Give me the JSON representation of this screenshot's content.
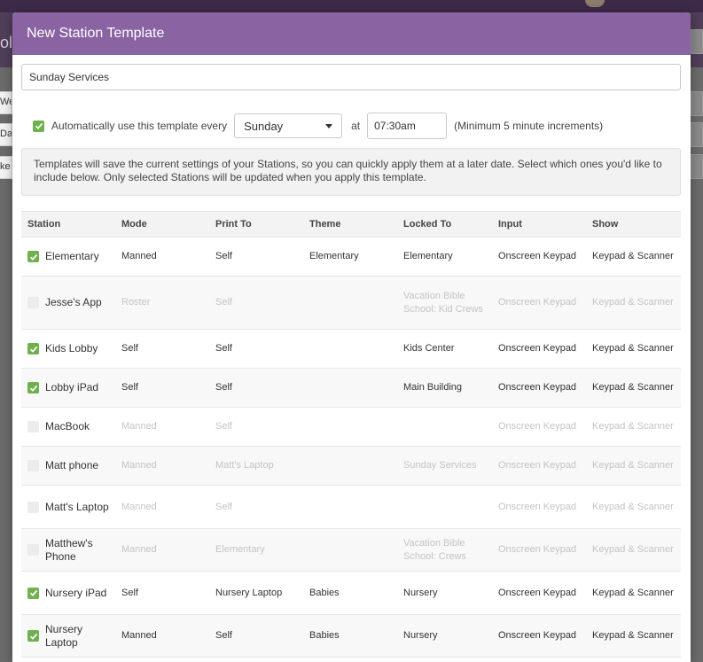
{
  "background": {
    "side_tabs": [
      "Wee",
      "Day",
      "ke"
    ],
    "logo_fragment": "ol"
  },
  "modal": {
    "title": "New Station Template",
    "template_name": "Sunday Services",
    "auto": {
      "checked": true,
      "label": "Automatically use this template every",
      "day": "Sunday",
      "at_label": "at",
      "time": "07:30am",
      "note": "(Minimum 5 minute increments)"
    },
    "info": "Templates will save the current settings of your Stations, so you can quickly apply them at a later date. Select which ones you'd like to include below. Only selected Stations will be updated when you apply this template.",
    "columns": [
      "Station",
      "Mode",
      "Print To",
      "Theme",
      "Locked To",
      "Input",
      "Show"
    ],
    "rows": [
      {
        "checked": true,
        "station": "Elementary",
        "mode": "Manned",
        "print_to": "Self",
        "theme": "Elementary",
        "locked_to": "Elementary",
        "input": "Onscreen Keypad",
        "show": "Keypad & Scanner"
      },
      {
        "checked": false,
        "station": "Jesse's App",
        "mode": "Roster",
        "print_to": "Self",
        "theme": "",
        "locked_to": "Vacation Bible School: Kid Crews",
        "input": "Onscreen Keypad",
        "show": "Keypad & Scanner"
      },
      {
        "checked": true,
        "station": "Kids Lobby",
        "mode": "Self",
        "print_to": "Self",
        "theme": "",
        "locked_to": "Kids Center",
        "input": "Onscreen Keypad",
        "show": "Keypad & Scanner"
      },
      {
        "checked": true,
        "station": "Lobby iPad",
        "mode": "Self",
        "print_to": "Self",
        "theme": "",
        "locked_to": "Main Building",
        "input": "Onscreen Keypad",
        "show": "Keypad & Scanner"
      },
      {
        "checked": false,
        "station": "MacBook",
        "mode": "Manned",
        "print_to": "Self",
        "theme": "",
        "locked_to": "",
        "input": "Onscreen Keypad",
        "show": "Keypad & Scanner"
      },
      {
        "checked": false,
        "station": "Matt phone",
        "mode": "Manned",
        "print_to": "Matt's Laptop",
        "theme": "",
        "locked_to": "Sunday Services",
        "input": "Onscreen Keypad",
        "show": "Keypad & Scanner"
      },
      {
        "checked": false,
        "station": "Matt's Laptop",
        "mode": "Manned",
        "print_to": "Self",
        "theme": "",
        "locked_to": "",
        "input": "Onscreen Keypad",
        "show": "Keypad & Scanner"
      },
      {
        "checked": false,
        "station": "Matthew's Phone",
        "mode": "Manned",
        "print_to": "Elementary",
        "theme": "",
        "locked_to": "Vacation Bible School: Crews",
        "input": "Onscreen Keypad",
        "show": "Keypad & Scanner"
      },
      {
        "checked": true,
        "station": "Nursery iPad",
        "mode": "Self",
        "print_to": "Nursery Laptop",
        "theme": "Babies",
        "locked_to": "Nursery",
        "input": "Onscreen Keypad",
        "show": "Keypad & Scanner"
      },
      {
        "checked": true,
        "station": "Nursery Laptop",
        "mode": "Manned",
        "print_to": "Self",
        "theme": "Babies",
        "locked_to": "Nursery",
        "input": "Onscreen Keypad",
        "show": "Keypad & Scanner"
      }
    ]
  },
  "colors": {
    "header": "#8a63a3",
    "check_on": "#6fb04f"
  }
}
